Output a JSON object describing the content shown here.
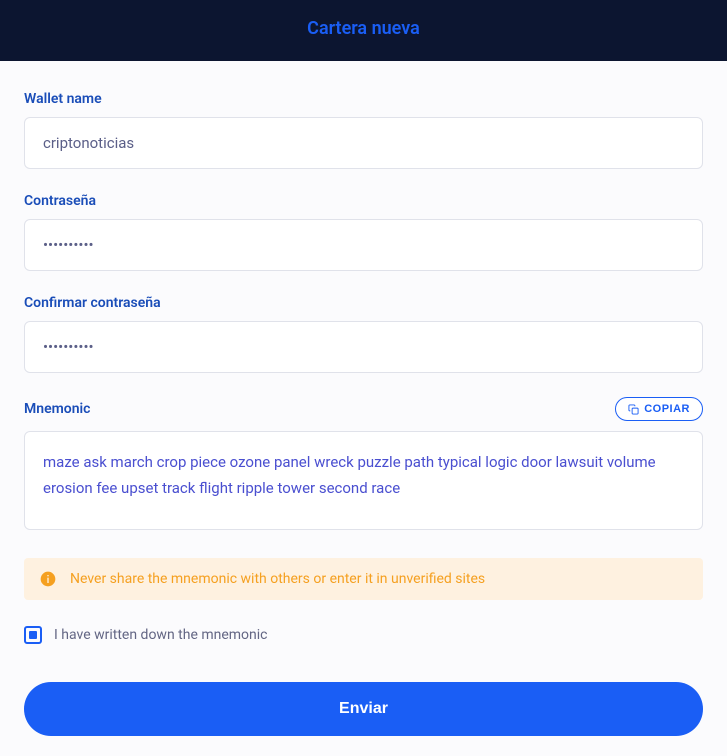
{
  "header": {
    "title": "Cartera nueva"
  },
  "fields": {
    "wallet_name": {
      "label": "Wallet name",
      "value": "criptonoticias"
    },
    "password": {
      "label": "Contraseña",
      "value": "••••••••••"
    },
    "confirm_password": {
      "label": "Confirmar contraseña",
      "value": "••••••••••"
    },
    "mnemonic": {
      "label": "Mnemonic",
      "copy_label": "COPIAR",
      "value": "maze ask march crop piece ozone panel wreck puzzle path typical logic door lawsuit volume erosion fee upset track flight ripple tower second race"
    }
  },
  "warning": {
    "text": "Never share the mnemonic with others or enter it in unverified sites"
  },
  "checkbox": {
    "label": "I have written down the mnemonic",
    "checked": true
  },
  "submit": {
    "label": "Enviar"
  }
}
